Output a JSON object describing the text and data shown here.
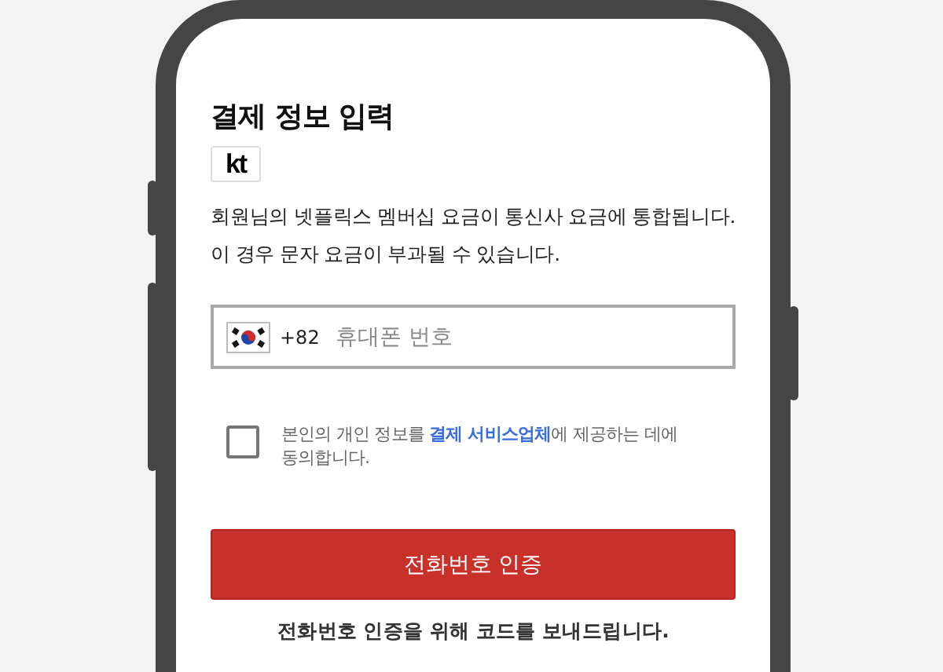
{
  "title": "결제 정보 입력",
  "carrier_logo": {
    "text": "kt"
  },
  "notice_lines": [
    "회원님의 넷플릭스 멤버십 요금이 통신사 요금에 통합됩니다.",
    "이 경우 문자 요금이 부과될 수 있습니다."
  ],
  "phone_field": {
    "country_code": "+82",
    "placeholder": "휴대폰 번호"
  },
  "consent": {
    "checked": false,
    "text_before": "본인의 개인 정보를 ",
    "link": "결제 서비스업체",
    "text_after": "에 제공하는 데에 동의합니다."
  },
  "submit_button": "전화번호 인증",
  "footnote": "전화번호 인증을 위해 코드를 보내드립니다."
}
